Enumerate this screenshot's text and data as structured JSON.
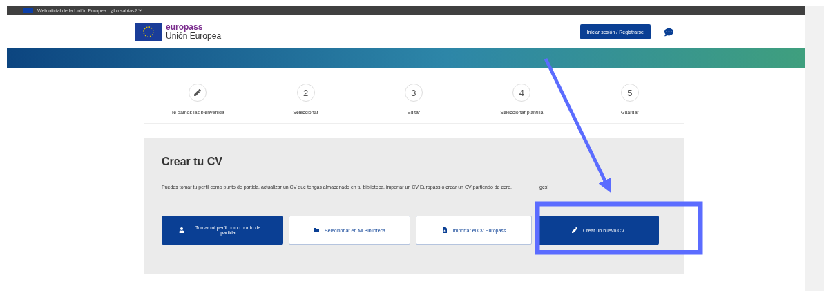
{
  "top_bar": {
    "official_text": "Web oficial de la Unión Europea",
    "menu": "¿Lo sabías?"
  },
  "header": {
    "brand": "europass",
    "subtitle": "Unión Europea",
    "login_button": "Iniciar sesión / Registrarse"
  },
  "steps": [
    {
      "kind": "edit",
      "label": "Te damos las bienvenida"
    },
    {
      "kind": "number",
      "number": "2",
      "label": "Seleccionar"
    },
    {
      "kind": "number",
      "number": "3",
      "label": "Editar"
    },
    {
      "kind": "number",
      "number": "4",
      "label": "Seleccionar plantilla"
    },
    {
      "kind": "number",
      "number": "5",
      "label": "Guardar"
    }
  ],
  "panel": {
    "title": "Crear tu CV",
    "description": "Puedes tomar tu perfil como punto de partida, actualizar un CV que tengas almacenado en tu biblioteca, importar un CV Europass o crear un CV partiendo de cero.",
    "description_tail": "ges!",
    "buttons": [
      {
        "kind": "primary",
        "label": "Tomar mi perfil como punto de partida"
      },
      {
        "kind": "outline",
        "label": "Seleccionar en Mi Biblioteca"
      },
      {
        "kind": "outline",
        "label": "Importar el CV Europass"
      },
      {
        "kind": "primary",
        "label": "Crear un nuevo CV"
      }
    ]
  }
}
